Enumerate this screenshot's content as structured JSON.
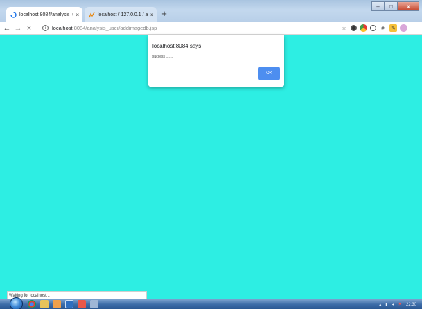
{
  "browser": {
    "tabs": [
      {
        "label": "localhost:8084/analysis_user/ad",
        "close": "×",
        "active": true
      },
      {
        "label": "localhost / 127.0.0.1 / analysis | p",
        "close": "×",
        "active": false
      }
    ],
    "new_tab": "+",
    "window_controls": {
      "minimize": "–",
      "maximize": "□",
      "close": "x"
    },
    "toolbar": {
      "back": "←",
      "forward": "→",
      "stop": "×",
      "url_host": "localhost",
      "url_rest": ":8084/analysis_user/addimagedb.jsp",
      "info_icon": "i"
    },
    "extensions": [
      "star-icon",
      "chrome-extension-icon",
      "color-extension-icon",
      "record-icon",
      "grid-extension-icon",
      "pen-extension-icon",
      "profile-icon",
      "menu-icon"
    ]
  },
  "dialog": {
    "title": "localhost:8084 says",
    "message": "success .......",
    "ok_label": "OK"
  },
  "status": {
    "text": "Waiting for localhost..."
  },
  "colors": {
    "page_background": "#2deee3",
    "ok_button": "#4d8ef0"
  },
  "taskbar": {
    "apps": [
      "chrome-icon",
      "explorer-icon",
      "file-manager-icon",
      "security-icon",
      "email-icon",
      "media-icon"
    ],
    "clock": "22:30"
  }
}
